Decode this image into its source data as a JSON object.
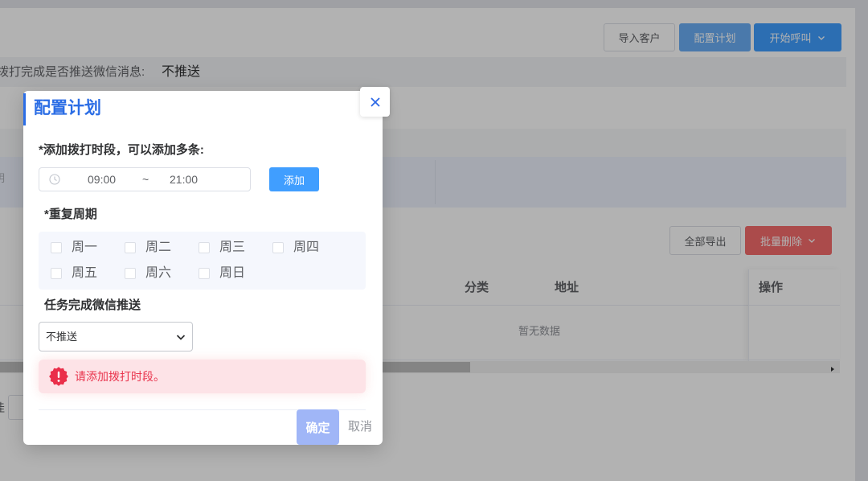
{
  "page": {
    "toolbar": {
      "import_label": "导入客户",
      "config_label": "配置计划",
      "start_call_label": "开始呼叫",
      "start_call_icon": "chevron-down-icon"
    },
    "push_setting": {
      "label": "拨打完成是否推送微信消息:",
      "value": "不推送"
    },
    "filter": {
      "partial_text": "明"
    },
    "actions": {
      "export_label": "全部导出",
      "batch_delete_label": "批量删除",
      "batch_delete_icon": "chevron-down-icon"
    },
    "table": {
      "columns": [
        "分类",
        "地址",
        "操作"
      ],
      "empty_text": "暂无数据",
      "scroll_icon": "arrow-right-icon"
    },
    "pagination": {
      "partial_text": "佳"
    }
  },
  "modal": {
    "title": "配置计划",
    "close_icon": "close-icon",
    "time_section": {
      "label": "*添加拨打时段，可以添加多条:",
      "icon": "clock-icon",
      "start": "09:00",
      "separator": "~",
      "end": "21:00",
      "add_label": "添加"
    },
    "repeat_section": {
      "label": "*重复周期",
      "days": [
        {
          "label": "周一",
          "checked": false
        },
        {
          "label": "周二",
          "checked": false
        },
        {
          "label": "周三",
          "checked": false
        },
        {
          "label": "周四",
          "checked": false
        },
        {
          "label": "周五",
          "checked": false
        },
        {
          "label": "周六",
          "checked": false
        },
        {
          "label": "周日",
          "checked": false
        }
      ]
    },
    "wechat_section": {
      "label": "任务完成微信推送",
      "selected": "不推送",
      "icon": "chevron-down-icon"
    },
    "alert": {
      "icon": "error-icon",
      "message": "请添加拨打时段。"
    },
    "footer": {
      "confirm_label": "确定",
      "confirm_disabled": true,
      "cancel_label": "取消"
    }
  },
  "colors": {
    "primary": "#409eff",
    "title": "#2b6de5",
    "danger": "#f56c6c",
    "alert_text": "#e9344d",
    "alert_bg": "#fde3e7",
    "confirm_disabled": "#a0b6f7",
    "overlay": "rgba(0, 0, 0, 0.3)"
  }
}
